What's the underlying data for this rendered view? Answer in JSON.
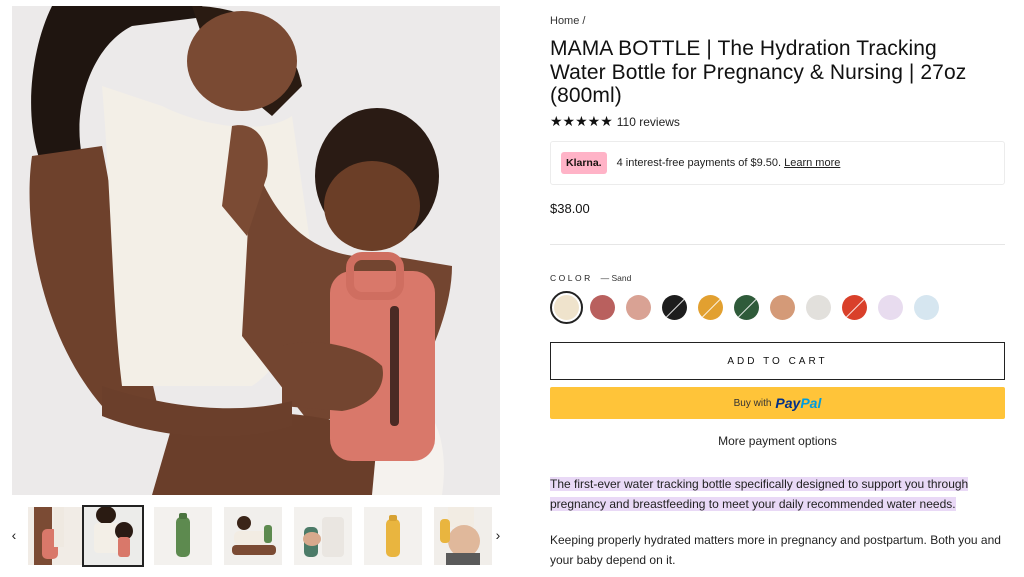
{
  "breadcrumb": {
    "home": "Home",
    "sep": "/"
  },
  "product": {
    "title": "MAMA BOTTLE | The Hydration Tracking Water Bottle for Pregnancy & Nursing | 27oz (800ml)",
    "stars": "★★★★★",
    "rating": 5,
    "reviews": "110 reviews",
    "price": "$38.00"
  },
  "klarna": {
    "badge": "Klarna.",
    "text": "4 interest-free payments of $9.50.",
    "link": "Learn more"
  },
  "color": {
    "label": "COLOR",
    "selected": "— Sand",
    "swatches": [
      {
        "name": "sand",
        "hex": "#efe3cc",
        "selected": true
      },
      {
        "name": "rose",
        "hex": "#b9605e"
      },
      {
        "name": "blush",
        "hex": "#d9a294"
      },
      {
        "name": "black",
        "hex": "#1d1d1d"
      },
      {
        "name": "mustard",
        "hex": "#e2a030"
      },
      {
        "name": "forest",
        "hex": "#2f5b3a"
      },
      {
        "name": "terracotta",
        "hex": "#d49a78"
      },
      {
        "name": "fog",
        "hex": "#e2e0dc"
      },
      {
        "name": "red",
        "hex": "#d9402a"
      },
      {
        "name": "lilac",
        "hex": "#e8dcef"
      },
      {
        "name": "sky",
        "hex": "#d6e6f0"
      }
    ]
  },
  "buttons": {
    "add_to_cart": "ADD TO CART",
    "buy_with": "Buy with",
    "paypal_a": "Pay",
    "paypal_b": "Pal",
    "more_payment": "More payment options"
  },
  "description": {
    "highlight": "The first-ever water tracking bottle specifically designed to support you through pregnancy and breastfeeding to meet your daily recommended water needs.",
    "para": "Keeping properly hydrated matters more in pregnancy and postpartum. Both you and your baby depend on it."
  },
  "thumbnails": {
    "prev": "‹",
    "next": "›",
    "items": [
      {
        "name": "bottle-carry"
      },
      {
        "name": "nursing-mother",
        "active": true
      },
      {
        "name": "green-bottle"
      },
      {
        "name": "mother-reclining"
      },
      {
        "name": "hand-bottle"
      },
      {
        "name": "yellow-bottle"
      },
      {
        "name": "pregnant-belly"
      }
    ]
  }
}
